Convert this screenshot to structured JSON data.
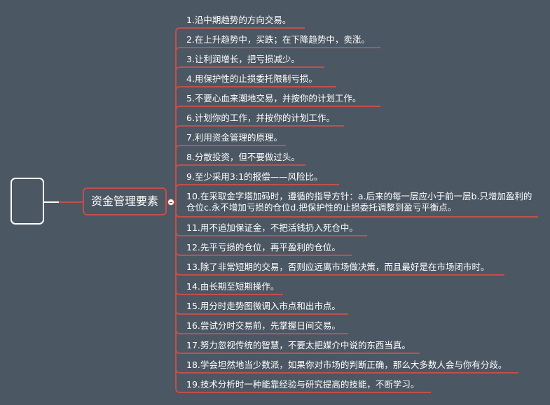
{
  "hub": {
    "label": "资金管理要素"
  },
  "colors": {
    "background": "#4b5763",
    "branch": "#c0504d",
    "root_border": "#ffffff",
    "text": "#ffffff"
  },
  "items": [
    {
      "label": "1.沿中期趋势的方向交易。"
    },
    {
      "label": "2.在上升趋势中，买跌；在下降趋势中，卖涨。"
    },
    {
      "label": "3.让利润增长，把亏损减少。"
    },
    {
      "label": "4.用保护性的止损委托限制亏损。"
    },
    {
      "label": "5.不要心血来潮地交易，并按你的计划工作。"
    },
    {
      "label": "6.计划你的工作，并按你的计划工作。"
    },
    {
      "label": "7.利用资金管理的原理。"
    },
    {
      "label": "8.分散投资，但不要做过头。"
    },
    {
      "label": "9.至少采用3:1的报偿——风险比。"
    },
    {
      "label": "10.在采取金字塔加码时，遵循的指导方针：a.后来的每一层应小于前一层b.只增加盈利的仓位c.永不增加亏损的仓位d.把保护性的止损委托调整到盈亏平衡点。"
    },
    {
      "label": "11.用不追加保证金，不把活钱扔入死仓中。"
    },
    {
      "label": "12.先平亏损的仓位，再平盈利的仓位。"
    },
    {
      "label": "13.除了非常短期的交易，否则应远离市场做决策，而且最好是在市场闭市时。"
    },
    {
      "label": "14.由长期至短期操作。"
    },
    {
      "label": "15.用分时走势图微调入市点和出市点。"
    },
    {
      "label": "16.尝试分时交易前，先掌握日间交易。"
    },
    {
      "label": "17.努力忽视传统的智慧，不要太把媒介中说的东西当真。"
    },
    {
      "label": "18.学会坦然地当少数派，如果你对市场的判断正确，那么大多数人会与你有分歧。"
    },
    {
      "label": "19.技术分析时一种能靠经验与研究提高的技能，不断学习。"
    }
  ]
}
